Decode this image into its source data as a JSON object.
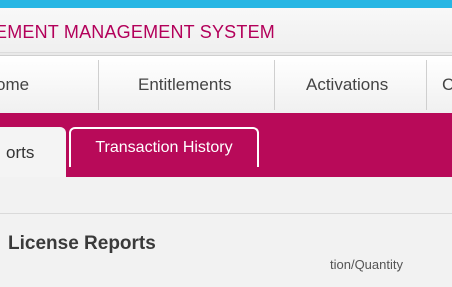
{
  "app": {
    "title": "EMENT MANAGEMENT SYSTEM"
  },
  "nav": {
    "items": [
      {
        "label": "ome"
      },
      {
        "label": "Entitlements"
      },
      {
        "label": "Activations"
      },
      {
        "label": "C"
      }
    ]
  },
  "subnav": {
    "tabs": [
      {
        "label": "orts",
        "active": true
      },
      {
        "label": "Transaction History",
        "active": false
      }
    ]
  },
  "content": {
    "section_title": "License Reports",
    "column_header": "tion/Quantity"
  },
  "colors": {
    "top_bar": "#27b6e4",
    "brand": "#b80a59",
    "title_text": "#b3005a"
  }
}
